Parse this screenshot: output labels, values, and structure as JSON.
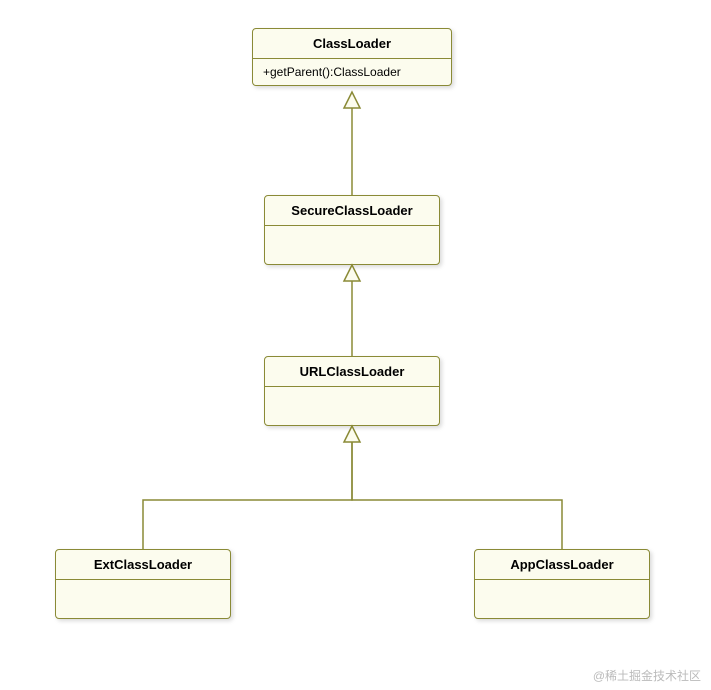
{
  "classes": {
    "classloader": {
      "name": "ClassLoader",
      "methods": [
        "+getParent():ClassLoader"
      ]
    },
    "secureclassloader": {
      "name": "SecureClassLoader",
      "methods": []
    },
    "urlclassloader": {
      "name": "URLClassLoader",
      "methods": []
    },
    "extclassloader": {
      "name": "ExtClassLoader",
      "methods": []
    },
    "appclassloader": {
      "name": "AppClassLoader",
      "methods": []
    }
  },
  "relationships": [
    {
      "child": "secureclassloader",
      "parent": "classloader",
      "type": "generalization"
    },
    {
      "child": "urlclassloader",
      "parent": "secureclassloader",
      "type": "generalization"
    },
    {
      "child": "extclassloader",
      "parent": "urlclassloader",
      "type": "generalization"
    },
    {
      "child": "appclassloader",
      "parent": "urlclassloader",
      "type": "generalization"
    }
  ],
  "watermark": "@稀土掘金技术社区"
}
